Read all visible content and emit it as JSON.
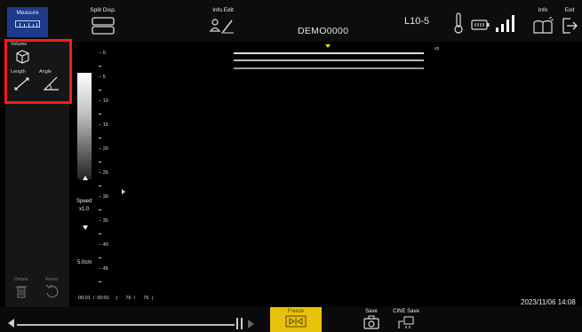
{
  "topbar": {
    "measure_label": "Measure",
    "split_disp_label": "Split Disp.",
    "info_edit_label": "Info.Edit",
    "info_label": "Info",
    "exit_label": "Exit",
    "probe": "L10-5",
    "patient_id": "DEMO0000"
  },
  "measure_tools": {
    "volume": "Volume",
    "length": "Length",
    "angle": "Angle"
  },
  "scale": {
    "depth_marks": [
      "0",
      "5",
      "10",
      "15",
      "20",
      "25",
      "30",
      "35",
      "40",
      "45"
    ],
    "vp_label": "vp",
    "speed_label": "Speed",
    "speed_value": "x1.0",
    "depth_value": "5.0cm"
  },
  "cine": {
    "info": "00:01  /  00:01     |      76  /      76  |"
  },
  "datetime": "2023/11/06 14:08",
  "bottom": {
    "delete_label": "Delete",
    "reset_label": "Reset",
    "freeze_label": "Freeze",
    "save_label": "Save",
    "cine_save_label": "CINE Save"
  },
  "colors": {
    "measure_active": "#1e3a8a",
    "freeze": "#e8c10a",
    "highlight": "#ff1a1a",
    "focus_marker": "#f5e200"
  }
}
